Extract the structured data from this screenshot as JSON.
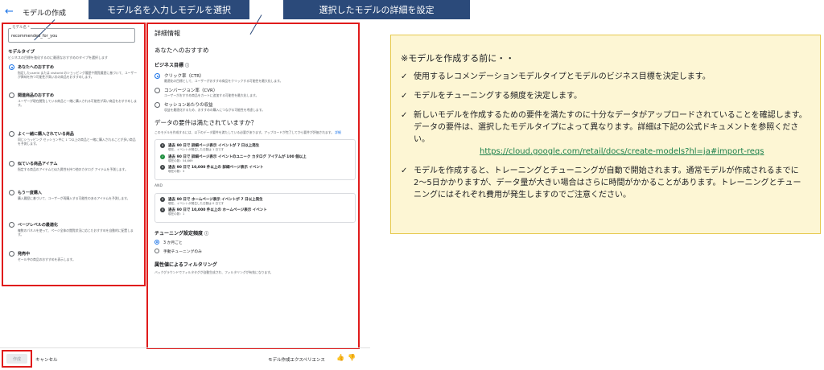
{
  "header": {
    "back_icon": "arrow-back-icon",
    "title": "モデルの作成"
  },
  "callouts": {
    "left": "モデル名を入力しモデルを選択",
    "right": "選択したモデルの詳細を設定"
  },
  "form": {
    "model_name_label": "モデル名 *",
    "model_name_value": "recommended_for_you",
    "model_type_title": "モデルタイプ",
    "model_type_hint": "ビジネスの目標を強化するのに最適なおすすめのタイプを選択します",
    "model_types": [
      {
        "label": "あなたへのおすすめ",
        "desc": "指定したuserId または visitorId のショッピング履歴や閲覧履歴に基づいて、ユーザーが興味を持つ可能性が高い次の商品をおすすめします。",
        "selected": true
      },
      {
        "label": "関連商品のおすすめ",
        "desc": "ユーザーが現在閲覧している商品と一緒に購入される可能性が高い商品をおすすめします。",
        "selected": false
      },
      {
        "label": "よく一緒に購入されている商品",
        "desc": "同じショッピング セッション中に 1 つ以上の商品と一緒に購入されることが多い商品を予測します。",
        "selected": false
      },
      {
        "label": "似ている商品アイテム",
        "desc": "指定する商品のアイテムと似た属性を持つ他のカタログ アイテムを予測します。",
        "selected": false
      },
      {
        "label": "もう一度購入",
        "desc": "購入履歴に基づいて、ユーザーが再購入する可能性のあるアイテムを予測します。",
        "selected": false
      },
      {
        "label": "ページレベルの最適化",
        "desc": "複数のパネルを使って、ページ全体の閲覧状況に応じたおすすめを自動的に配置します。",
        "selected": false
      },
      {
        "label": "発売中",
        "desc": "セール中の商品のおすすめを表示します。",
        "selected": false
      }
    ]
  },
  "details": {
    "title": "詳細情報",
    "model_kind": "あなたへのおすすめ",
    "goal_title": "ビジネス目標",
    "goals": [
      {
        "label": "クリック率（CTR）",
        "desc": "最適化の目標として、ユーザーがおすすめ商品をクリックする可能性を最大化します。",
        "selected": true
      },
      {
        "label": "コンバージョン率（CVR）",
        "desc": "ユーザーがおすすめ商品をカートに追加する可能性を最大化します。",
        "selected": false
      },
      {
        "label": "セッションあたりの収益",
        "desc": "収益を最適化するため、おすすめの購入につながる可能性を考慮します。",
        "selected": false
      }
    ],
    "req_title": "データの要件は満たされていますか？",
    "req_desc": "このモデルを作成するには、以下のデータ要件を満たしている必要があります。アップロードが完了してから要件が評価されます。",
    "req_link": "詳細",
    "requirements_group1": [
      {
        "title": "過去 90 日で 詳細ページ表示 イベントが 7 日以上発生",
        "sub": "現在、イベントが発生した日数は 1 日です",
        "status": "err"
      },
      {
        "title": "過去 90 日で 詳細ページ表示 イベントのユニーク カタログ アイテムが 100 個以上",
        "sub": "現在の数：54,669",
        "status": "ok"
      },
      {
        "title": "過去 90 日で 10,000 件以上の 詳細ページ表示 イベント",
        "sub": "現在の数：3",
        "status": "err"
      }
    ],
    "and_label": "AND",
    "requirements_group2": [
      {
        "title": "過去 90 日で ホームページ表示 イベントが 7 日以上発生",
        "sub": "現在、イベントが発生した日数は 0 日です",
        "status": "err"
      },
      {
        "title": "過去 90 日で 10,000 件以上の ホームページ表示 イベント",
        "sub": "現在の数：1",
        "status": "err"
      }
    ],
    "tune_title": "チューニング設定頻度",
    "tune_options": [
      {
        "label": "3 か月ごと",
        "selected": true
      },
      {
        "label": "手動チューニングのみ",
        "selected": false
      }
    ],
    "filter_title": "属性値によるフィルタリング",
    "filter_desc": "バックグラウンドでフィルタタグが自動生成され、フィルタリングが有効になります。"
  },
  "footer": {
    "create": "作成",
    "cancel": "キャンセル",
    "experience": "モデル作成エクスペリエンス",
    "thumb_up_icon": "thumb-up-icon",
    "thumb_down_icon": "thumb-down-icon"
  },
  "note": {
    "intro": "※モデルを作成する前に・・",
    "items": [
      "使用するレコメンデーションモデルタイプとモデルのビジネス目標を決定します。",
      "モデルをチューニングする頻度を決定します。",
      "新しいモデルを作成するための要件を満たすのに十分なデータがアップロードされていることを確認します。データの要件は、選択したモデルタイプによって異なります。詳細は下記の公式ドキュメントを参照ください。",
      "モデルを作成すると、トレーニングとチューニングが自動で開始されます。通常モデルが作成されるまでに2〜5日かかりますが、データ量が大きい場合はさらに時間がかかることがあります。トレーニングとチューニングにはそれぞれ費用が発生しますのでご注意ください。"
    ],
    "url": "https://cloud.google.com/retail/docs/create-models?hl=ja#import-reqs"
  },
  "colors": {
    "accent": "#1a73e8",
    "highlight_border": "#e01b1b",
    "callout_bg": "#2b4a7a",
    "note_bg": "#fdf6d4"
  }
}
